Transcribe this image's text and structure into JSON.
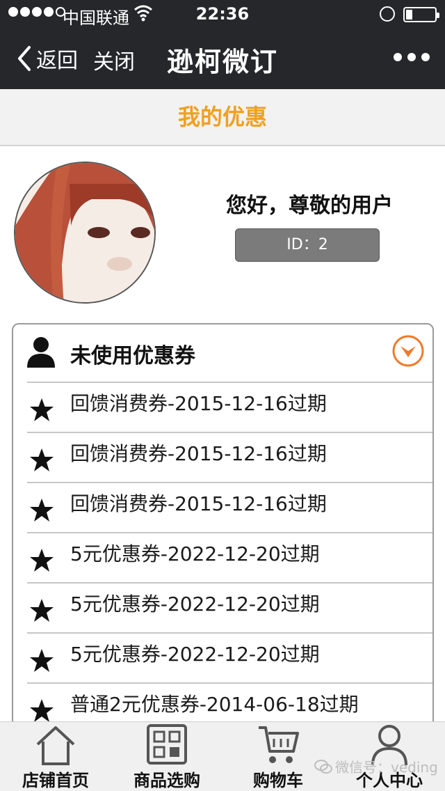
{
  "status_bar": {
    "carrier": "中国联通",
    "time": "22:36"
  },
  "nav": {
    "back_label": "返回",
    "close_label": "关闭",
    "title": "逊柯微订"
  },
  "page": {
    "title": "我的优惠"
  },
  "profile": {
    "greeting": "您好，尊敬的用户",
    "id_text": "ID：2"
  },
  "coupons": {
    "header": "未使用优惠券",
    "items": [
      "回馈消费券-2015-12-16过期",
      "回馈消费券-2015-12-16过期",
      "回馈消费券-2015-12-16过期",
      "5元优惠券-2022-12-20过期",
      "5元优惠券-2022-12-20过期",
      "5元优惠券-2022-12-20过期",
      "普通2元优惠券-2014-06-18过期"
    ]
  },
  "tabs": [
    {
      "label": "店铺首页",
      "icon": "home-icon"
    },
    {
      "label": "商品选购",
      "icon": "grid-icon"
    },
    {
      "label": "购物车",
      "icon": "cart-icon"
    },
    {
      "label": "个人中心",
      "icon": "person-icon"
    }
  ],
  "watermark": "微信号：veding",
  "colors": {
    "bar_dark": "#25272b",
    "accent_orange": "#f0a020",
    "toggle_orange": "#f07a2a"
  }
}
